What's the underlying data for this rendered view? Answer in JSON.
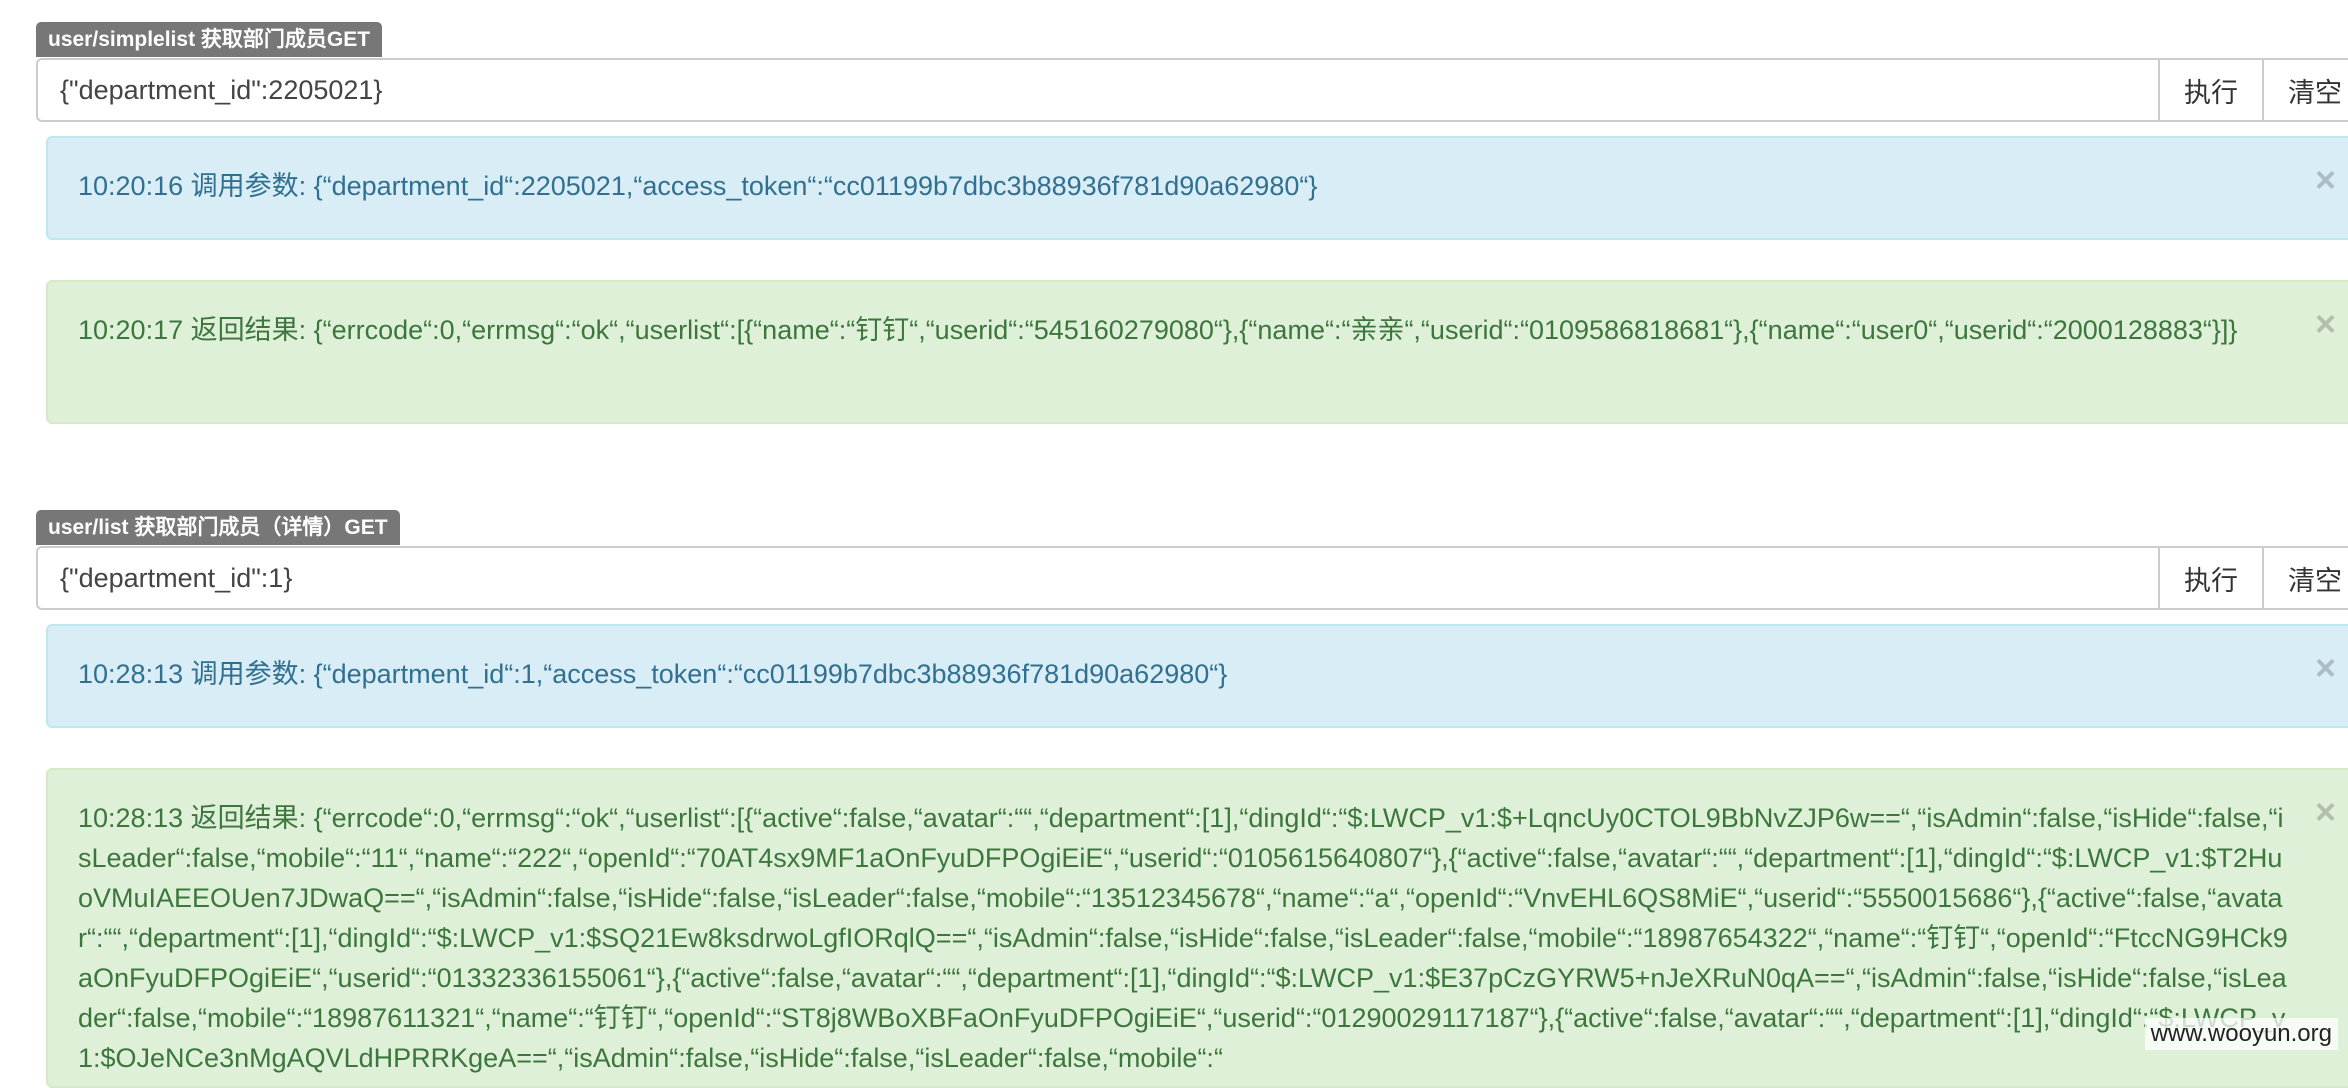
{
  "sections": [
    {
      "label": "user/simplelist 获取部门成员GET",
      "input_value": "{\"department_id\":2205021}",
      "execute_label": "执行",
      "clear_label": "清空",
      "params_alert": "10:20:16 调用参数: {“department_id“:2205021,“access_token“:“cc01199b7dbc3b88936f781d90a62980“}",
      "result_alert": "10:20:17 返回结果: {“errcode“:0,“errmsg“:“ok“,“userlist“:[{“name“:“钉钉“,“userid“:“545160279080“},{“name“:“亲亲“,“userid“:“0109586818681“},{“name“:“user0“,“userid“:“2000128883“}]}",
      "close_glyph": "×"
    },
    {
      "label": "user/list 获取部门成员（详情）GET",
      "input_value": "{\"department_id\":1}",
      "execute_label": "执行",
      "clear_label": "清空",
      "params_alert": "10:28:13 调用参数: {“department_id“:1,“access_token“:“cc01199b7dbc3b88936f781d90a62980“}",
      "result_alert": "10:28:13 返回结果: {“errcode“:0,“errmsg“:“ok“,“userlist“:[{“active“:false,“avatar“:““,“department“:[1],“dingId“:“$:LWCP_v1:$+LqncUy0CTOL9BbNvZJP6w==“,“isAdmin“:false,“isHide“:false,“isLeader“:false,“mobile“:“11“,“name“:“222“,“openId“:“70AT4sx9MF1aOnFyuDFPOgiEiE“,“userid“:“0105615640807“},{“active“:false,“avatar“:““,“department“:[1],“dingId“:“$:LWCP_v1:$T2HuoVMuIAEEOUen7JDwaQ==“,“isAdmin“:false,“isHide“:false,“isLeader“:false,“mobile“:“13512345678“,“name“:“a“,“openId“:“VnvEHL6QS8MiE“,“userid“:“5550015686“},{“active“:false,“avatar“:““,“department“:[1],“dingId“:“$:LWCP_v1:$SQ21Ew8ksdrwoLgfIORqlQ==“,“isAdmin“:false,“isHide“:false,“isLeader“:false,“mobile“:“18987654322“,“name“:“钉钉“,“openId“:“FtccNG9HCk9aOnFyuDFPOgiEiE“,“userid“:“01332336155061“},{“active“:false,“avatar“:““,“department“:[1],“dingId“:“$:LWCP_v1:$E37pCzGYRW5+nJeXRuN0qA==“,“isAdmin“:false,“isHide“:false,“isLeader“:false,“mobile“:“18987611321“,“name“:“钉钉“,“openId“:“ST8j8WBoXBFaOnFyuDFPOgiEiE“,“userid“:“01290029117187“},{“active“:false,“avatar“:““,“department“:[1],“dingId“:“$:LWCP_v1:$OJeNCe3nMgAQVLdHPRRKgeA==“,“isAdmin“:false,“isHide“:false,“isLeader“:false,“mobile“:“",
      "close_glyph": "×"
    }
  ],
  "watermark": "www.wooyun.org"
}
